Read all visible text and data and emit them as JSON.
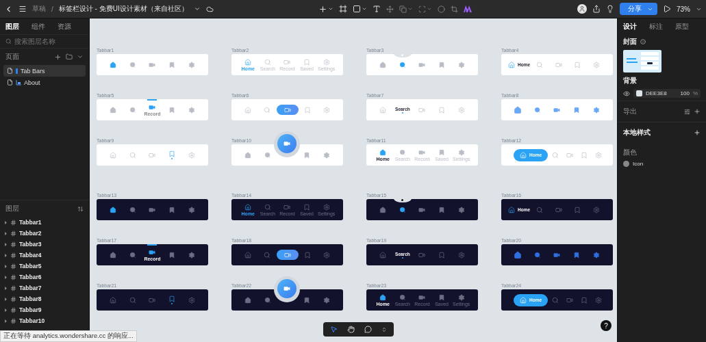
{
  "toolbar": {
    "breadcrumb_root": "草稿",
    "separator": "/",
    "file_name": "标签栏设计 - 免费UI设计素材（来自社区）",
    "share_button": "分享",
    "zoom": "73%"
  },
  "left_panel": {
    "tabs": [
      {
        "label": "图层",
        "selected": true
      },
      {
        "label": "组件",
        "selected": false
      },
      {
        "label": "资源",
        "selected": false
      }
    ],
    "search": {
      "placeholder": "搜索图层名称"
    },
    "pages_title": "页面",
    "pages": [
      {
        "name": "Tab Bars",
        "selected": true
      },
      {
        "name": "About",
        "selected": false
      }
    ],
    "layers_title": "图层",
    "layers": [
      {
        "name": "Tabbar1",
        "expanded": false
      },
      {
        "name": "Tabbar2",
        "expanded": false
      },
      {
        "name": "Tabbar3",
        "expanded": false
      },
      {
        "name": "Tabbar4",
        "expanded": false
      },
      {
        "name": "Tabbar5",
        "expanded": false
      },
      {
        "name": "Tabbar6",
        "expanded": false
      },
      {
        "name": "Tabbar7",
        "expanded": false
      },
      {
        "name": "Tabbar8",
        "expanded": false
      },
      {
        "name": "Tabbar9",
        "expanded": false
      },
      {
        "name": "Tabbar10",
        "expanded": false
      }
    ]
  },
  "right_panel": {
    "tabs": [
      {
        "label": "设计",
        "selected": true
      },
      {
        "label": "标注",
        "selected": false
      },
      {
        "label": "原型",
        "selected": false
      }
    ],
    "cover_title": "封面",
    "background_title": "背景",
    "background": {
      "hex": "DEE3E8",
      "opacity": "100",
      "unit": "%"
    },
    "export_title": "导出",
    "local_styles_title": "本地样式",
    "colors_title": "颜色",
    "color_styles": [
      {
        "name": "Icon"
      }
    ]
  },
  "canvas": {
    "frames": [
      {
        "name": "Tabbar1",
        "dark": false,
        "kind": "plain",
        "items": [
          {
            "selected": true
          },
          {
            "selected": false
          },
          {
            "selected": false
          },
          {
            "selected": false
          },
          {
            "selected": false
          }
        ]
      },
      {
        "name": "Tabbar2",
        "dark": false,
        "kind": "labeled",
        "items": [
          {
            "selected": true,
            "label": "Home"
          },
          {
            "selected": false,
            "label": "Search"
          },
          {
            "selected": false,
            "label": "Record"
          },
          {
            "selected": false,
            "label": "Saved"
          },
          {
            "selected": false,
            "label": "Settings"
          }
        ]
      },
      {
        "name": "Tabbar3",
        "dark": false,
        "kind": "notch",
        "items": [
          {
            "selected": false
          },
          {
            "selected": true
          },
          {
            "selected": false
          },
          {
            "selected": false
          },
          {
            "selected": false
          }
        ]
      },
      {
        "name": "Tabbar4",
        "dark": false,
        "kind": "pill-label",
        "items": [
          {
            "selected": true,
            "label": "Home"
          },
          {
            "selected": false
          },
          {
            "selected": false
          },
          {
            "selected": false
          },
          {
            "selected": false
          }
        ]
      },
      {
        "name": "Tabbar5",
        "dark": false,
        "kind": "top-indicator",
        "items": [
          {
            "selected": false
          },
          {
            "selected": false
          },
          {
            "selected": true,
            "label": "Record"
          },
          {
            "selected": false
          },
          {
            "selected": false
          }
        ]
      },
      {
        "name": "Tabbar6",
        "dark": false,
        "kind": "pill",
        "items": [
          {
            "selected": false
          },
          {
            "selected": false
          },
          {
            "selected": true
          },
          {
            "selected": false
          },
          {
            "selected": false
          }
        ]
      },
      {
        "name": "Tabbar7",
        "dark": false,
        "kind": "text",
        "items": [
          {
            "selected": false
          },
          {
            "selected": true,
            "label": "Search"
          },
          {
            "selected": false
          },
          {
            "selected": false
          },
          {
            "selected": false
          }
        ]
      },
      {
        "name": "Tabbar8",
        "dark": false,
        "kind": "gradient",
        "items": [
          {
            "selected": true
          },
          {
            "selected": false
          },
          {
            "selected": false
          },
          {
            "selected": false
          },
          {
            "selected": false
          }
        ]
      },
      {
        "name": "Tabbar9",
        "dark": false,
        "kind": "dot",
        "items": [
          {
            "selected": false
          },
          {
            "selected": false
          },
          {
            "selected": false
          },
          {
            "selected": true
          },
          {
            "selected": false
          }
        ]
      },
      {
        "name": "Tabbar10",
        "dark": false,
        "kind": "fab",
        "items": [
          {
            "selected": false
          },
          {
            "selected": false
          },
          {
            "selected": true
          },
          {
            "selected": false
          },
          {
            "selected": false
          }
        ]
      },
      {
        "name": "Tabbar11",
        "dark": false,
        "kind": "labeled-filled",
        "items": [
          {
            "selected": true,
            "label": "Home"
          },
          {
            "selected": false,
            "label": "Search"
          },
          {
            "selected": false,
            "label": "Record"
          },
          {
            "selected": false,
            "label": "Saved"
          },
          {
            "selected": false,
            "label": "Settings"
          }
        ]
      },
      {
        "name": "Tabbar12",
        "dark": false,
        "kind": "solid-pill",
        "items": [
          {
            "selected": true,
            "label": "Home"
          },
          {
            "selected": false
          },
          {
            "selected": false
          },
          {
            "selected": false
          },
          {
            "selected": false
          }
        ]
      },
      {
        "name": "Tabbar13",
        "dark": true,
        "kind": "plain",
        "items": [
          {
            "selected": true
          },
          {
            "selected": false
          },
          {
            "selected": false
          },
          {
            "selected": false
          },
          {
            "selected": false
          }
        ]
      },
      {
        "name": "Tabbar14",
        "dark": true,
        "kind": "labeled",
        "items": [
          {
            "selected": true,
            "label": "Home"
          },
          {
            "selected": false,
            "label": "Search"
          },
          {
            "selected": false,
            "label": "Record"
          },
          {
            "selected": false,
            "label": "Saved"
          },
          {
            "selected": false,
            "label": "Settings"
          }
        ]
      },
      {
        "name": "Tabbar15",
        "dark": true,
        "kind": "notch",
        "items": [
          {
            "selected": false
          },
          {
            "selected": true
          },
          {
            "selected": false
          },
          {
            "selected": false
          },
          {
            "selected": false
          }
        ]
      },
      {
        "name": "Tabbar16",
        "dark": true,
        "kind": "pill-label",
        "items": [
          {
            "selected": true,
            "label": "Home"
          },
          {
            "selected": false
          },
          {
            "selected": false
          },
          {
            "selected": false
          },
          {
            "selected": false
          }
        ]
      },
      {
        "name": "Tabbar17",
        "dark": true,
        "kind": "top-indicator",
        "items": [
          {
            "selected": false
          },
          {
            "selected": false
          },
          {
            "selected": true,
            "label": "Record"
          },
          {
            "selected": false
          },
          {
            "selected": false
          }
        ]
      },
      {
        "name": "Tabbar18",
        "dark": true,
        "kind": "pill",
        "items": [
          {
            "selected": false
          },
          {
            "selected": false
          },
          {
            "selected": true
          },
          {
            "selected": false
          },
          {
            "selected": false
          }
        ]
      },
      {
        "name": "Tabbar19",
        "dark": true,
        "kind": "text",
        "items": [
          {
            "selected": false
          },
          {
            "selected": true,
            "label": "Search"
          },
          {
            "selected": false
          },
          {
            "selected": false
          },
          {
            "selected": false
          }
        ]
      },
      {
        "name": "Tabbar20",
        "dark": true,
        "kind": "gradient",
        "items": [
          {
            "selected": true
          },
          {
            "selected": false
          },
          {
            "selected": false
          },
          {
            "selected": false
          },
          {
            "selected": false
          }
        ]
      },
      {
        "name": "Tabbar21",
        "dark": true,
        "kind": "dot",
        "items": [
          {
            "selected": false
          },
          {
            "selected": false
          },
          {
            "selected": false
          },
          {
            "selected": true
          },
          {
            "selected": false
          }
        ]
      },
      {
        "name": "Tabbar22",
        "dark": true,
        "kind": "fab",
        "items": [
          {
            "selected": false
          },
          {
            "selected": false
          },
          {
            "selected": true
          },
          {
            "selected": false
          },
          {
            "selected": false
          }
        ]
      },
      {
        "name": "Tabbar23",
        "dark": true,
        "kind": "labeled-filled",
        "items": [
          {
            "selected": true,
            "label": "Home"
          },
          {
            "selected": false,
            "label": "Search"
          },
          {
            "selected": false,
            "label": "Record"
          },
          {
            "selected": false,
            "label": "Saved"
          },
          {
            "selected": false,
            "label": "Settings"
          }
        ]
      },
      {
        "name": "Tabbar24",
        "dark": true,
        "kind": "solid-pill",
        "items": [
          {
            "selected": true,
            "label": "Home"
          },
          {
            "selected": false
          },
          {
            "selected": false
          },
          {
            "selected": false
          },
          {
            "selected": false
          }
        ]
      }
    ]
  },
  "help_button": "?",
  "status_text": "正在等待 analytics.wondershare.cc 的响应..."
}
